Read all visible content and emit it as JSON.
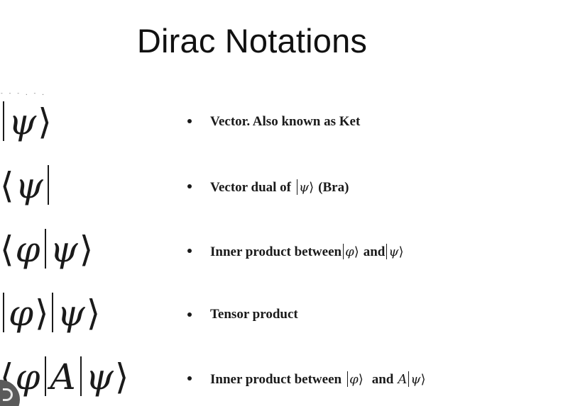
{
  "title": "Dirac Notations",
  "artifact_text": "- - - . - . - -",
  "rows": [
    {
      "notation": {
        "left": "|",
        "sym1": "ψ",
        "right": "⟩"
      },
      "description": "Vector. Also known as Ket"
    },
    {
      "notation": {
        "left": "⟨",
        "sym1": "ψ",
        "right": "|"
      },
      "description_prefix": "Vector dual of",
      "description_inline": "ψ",
      "description_suffix": "(Bra)"
    },
    {
      "notation": {
        "left": "⟨",
        "sym1": "φ",
        "sym2": "ψ",
        "right": "⟩"
      },
      "description_prefix": "Inner product between",
      "inline_1": "φ",
      "description_middle": "and",
      "inline_2": "ψ"
    },
    {
      "notation": {
        "sym1": "φ",
        "sym2": "ψ",
        "right": "⟩"
      },
      "description": "Tensor product"
    },
    {
      "notation": {
        "left": "⟨",
        "sym1": "φ",
        "sym2": "A",
        "sym3": "ψ",
        "right": "⟩"
      },
      "description_prefix": "Inner product between",
      "inline_1": "φ",
      "description_middle": "and",
      "inline_op": "A",
      "inline_2": "ψ"
    }
  ]
}
